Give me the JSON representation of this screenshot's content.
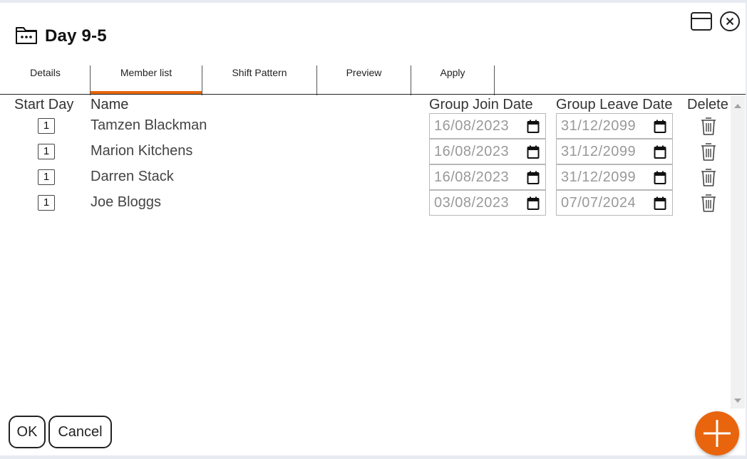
{
  "dialog": {
    "title": "Day 9-5",
    "icons": {
      "title": "folder-icon",
      "maximize": "maximize-icon",
      "close": "close-icon"
    }
  },
  "tabs": [
    {
      "label": "Details",
      "active": false
    },
    {
      "label": "Member list",
      "active": true
    },
    {
      "label": "Shift Pattern",
      "active": false
    },
    {
      "label": "Preview",
      "active": false
    },
    {
      "label": "Apply",
      "active": false
    }
  ],
  "table": {
    "headers": {
      "start_day": "Start Day",
      "name": "Name",
      "join_date": "Group Join Date",
      "leave_date": "Group Leave Date",
      "delete": "Delete"
    },
    "rows": [
      {
        "start_day": "1",
        "name": "Tamzen Blackman",
        "join_date": "16/08/2023",
        "leave_date": "31/12/2099"
      },
      {
        "start_day": "1",
        "name": "Marion Kitchens",
        "join_date": "16/08/2023",
        "leave_date": "31/12/2099"
      },
      {
        "start_day": "1",
        "name": "Darren Stack",
        "join_date": "16/08/2023",
        "leave_date": "31/12/2099"
      },
      {
        "start_day": "1",
        "name": "Joe Bloggs",
        "join_date": "03/08/2023",
        "leave_date": "07/07/2024"
      }
    ]
  },
  "footer": {
    "ok_label": "OK",
    "cancel_label": "Cancel",
    "add_icon": "plus-icon"
  },
  "colors": {
    "accent": "#e8650e"
  }
}
